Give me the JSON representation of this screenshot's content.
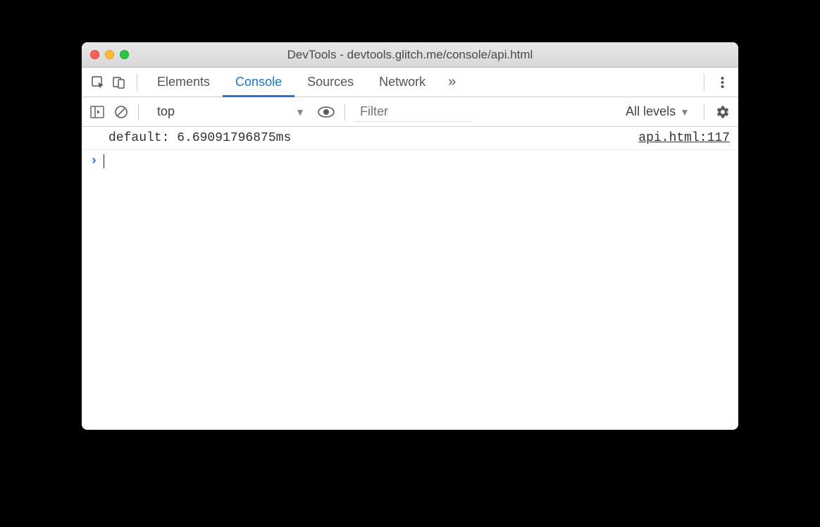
{
  "window": {
    "title": "DevTools - devtools.glitch.me/console/api.html"
  },
  "tabs": {
    "items": [
      "Elements",
      "Console",
      "Sources",
      "Network"
    ],
    "active_index": 1
  },
  "filterbar": {
    "context": "top",
    "filter_placeholder": "Filter",
    "levels_label": "All levels"
  },
  "console": {
    "entries": [
      {
        "message": "default: 6.69091796875ms",
        "source": "api.html:117"
      }
    ]
  }
}
